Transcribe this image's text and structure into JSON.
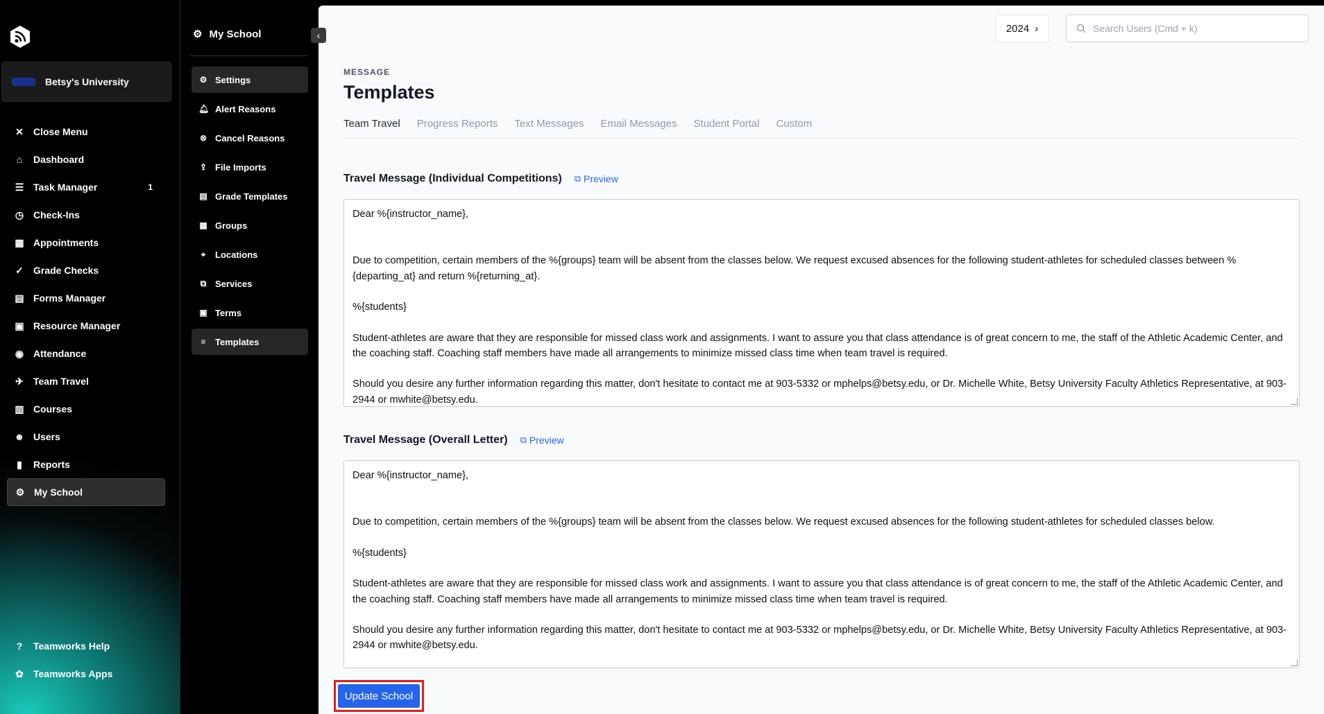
{
  "org": {
    "name": "Betsy's University"
  },
  "nav": {
    "items": [
      {
        "label": "Close Menu",
        "icon": "close-icon"
      },
      {
        "label": "Dashboard",
        "icon": "home-icon"
      },
      {
        "label": "Task Manager",
        "icon": "checklist-icon",
        "count": "1"
      },
      {
        "label": "Check-Ins",
        "icon": "alarm-icon"
      },
      {
        "label": "Appointments",
        "icon": "calendar-icon"
      },
      {
        "label": "Grade Checks",
        "icon": "grade-icon"
      },
      {
        "label": "Forms Manager",
        "icon": "form-icon"
      },
      {
        "label": "Resource Manager",
        "icon": "resource-icon"
      },
      {
        "label": "Attendance",
        "icon": "attendance-icon"
      },
      {
        "label": "Team Travel",
        "icon": "plane-icon"
      },
      {
        "label": "Courses",
        "icon": "book-icon"
      },
      {
        "label": "Users",
        "icon": "users-icon"
      },
      {
        "label": "Reports",
        "icon": "chart-icon"
      },
      {
        "label": "My School",
        "icon": "gear-icon"
      }
    ],
    "bottom": [
      {
        "label": "Teamworks Help",
        "icon": "help-icon"
      },
      {
        "label": "Teamworks Apps",
        "icon": "apps-icon"
      }
    ]
  },
  "subnav": {
    "title": "My School",
    "items": [
      {
        "label": "Settings"
      },
      {
        "label": "Alert Reasons"
      },
      {
        "label": "Cancel Reasons"
      },
      {
        "label": "File Imports"
      },
      {
        "label": "Grade Templates"
      },
      {
        "label": "Groups"
      },
      {
        "label": "Locations"
      },
      {
        "label": "Services"
      },
      {
        "label": "Terms"
      },
      {
        "label": "Templates"
      }
    ]
  },
  "header": {
    "year": "2024",
    "search_placeholder": "Search Users (Cmd + k)"
  },
  "page": {
    "eyebrow": "MESSAGE",
    "title": "Templates",
    "tabs": [
      "Team Travel",
      "Progress Reports",
      "Text Messages",
      "Email Messages",
      "Student Portal",
      "Custom"
    ]
  },
  "sections": [
    {
      "title": "Travel Message (Individual Competitions)",
      "preview": "Preview",
      "paragraphs": [
        "Dear %{instructor_name},",
        "",
        "Due to competition, certain members of the %{groups} team will be absent from the classes below. We request excused absences for the following student-athletes for scheduled classes between %{departing_at} and return %{returning_at}.",
        "%{students}",
        "Student-athletes are aware that they are responsible for missed class work and assignments. I want to assure you that class attendance is of great concern to me, the staff of the Athletic Academic Center, and the coaching staff. Coaching staff members have made all arrangements to minimize missed class time when team travel is required.",
        "Should you desire any further information regarding this matter, don't hesitate to contact me at 903-5332 or mphelps@betsy.edu, or Dr. Michelle White, Betsy University Faculty Athletics Representative, at 903-2944 or mwhite@betsy.edu."
      ]
    },
    {
      "title": "Travel Message (Overall Letter)",
      "preview": "Preview",
      "paragraphs": [
        "Dear %{instructor_name},",
        "",
        "Due to competition, certain members of the %{groups} team will be absent from the classes below. We request excused absences for the following student-athletes for scheduled classes below.",
        "%{students}",
        "Student-athletes are aware that they are responsible for missed class work and assignments. I want to assure you that class attendance is of great concern to me, the staff of the Athletic Academic Center, and the coaching staff. Coaching staff members have made all arrangements to minimize missed class time when team travel is required.",
        "Should you desire any further information regarding this matter, don't hesitate to contact me at 903-5332 or mphelps@betsy.edu, or Dr. Michelle White, Betsy University Faculty Athletics Representative, at 903-2944 or mwhite@betsy.edu."
      ]
    }
  ],
  "actions": {
    "update": "Update School"
  }
}
